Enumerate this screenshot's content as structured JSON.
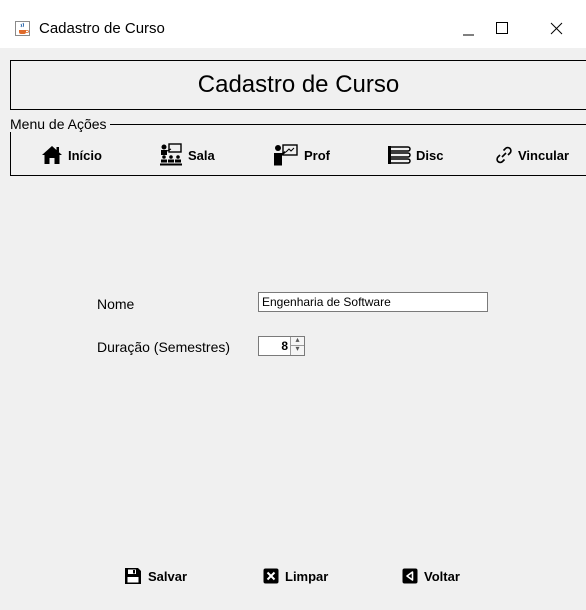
{
  "window": {
    "title": "Cadastro de Curso",
    "icon": "java-cup-icon",
    "controls": [
      "minimize-icon",
      "maximize-icon",
      "close-icon"
    ]
  },
  "header": {
    "title": "Cadastro de Curso"
  },
  "menu": {
    "legend": "Menu de Ações",
    "items": [
      {
        "label": "Início",
        "icon": "home-icon"
      },
      {
        "label": "Sala",
        "icon": "classroom-icon"
      },
      {
        "label": "Prof",
        "icon": "teacher-board-icon"
      },
      {
        "label": "Disc",
        "icon": "books-icon"
      },
      {
        "label": "Vincular",
        "icon": "link-icon"
      }
    ]
  },
  "form": {
    "nome_label": "Nome",
    "nome_value": "Engenharia de Software",
    "duracao_label": "Duração (Semestres)",
    "duracao_value": "8"
  },
  "actions": {
    "salvar": "Salvar",
    "limpar": "Limpar",
    "voltar": "Voltar"
  },
  "colors": {
    "window_bg": "#f0f0f0",
    "titlebar_bg": "#ffffff",
    "border": "#000000"
  }
}
